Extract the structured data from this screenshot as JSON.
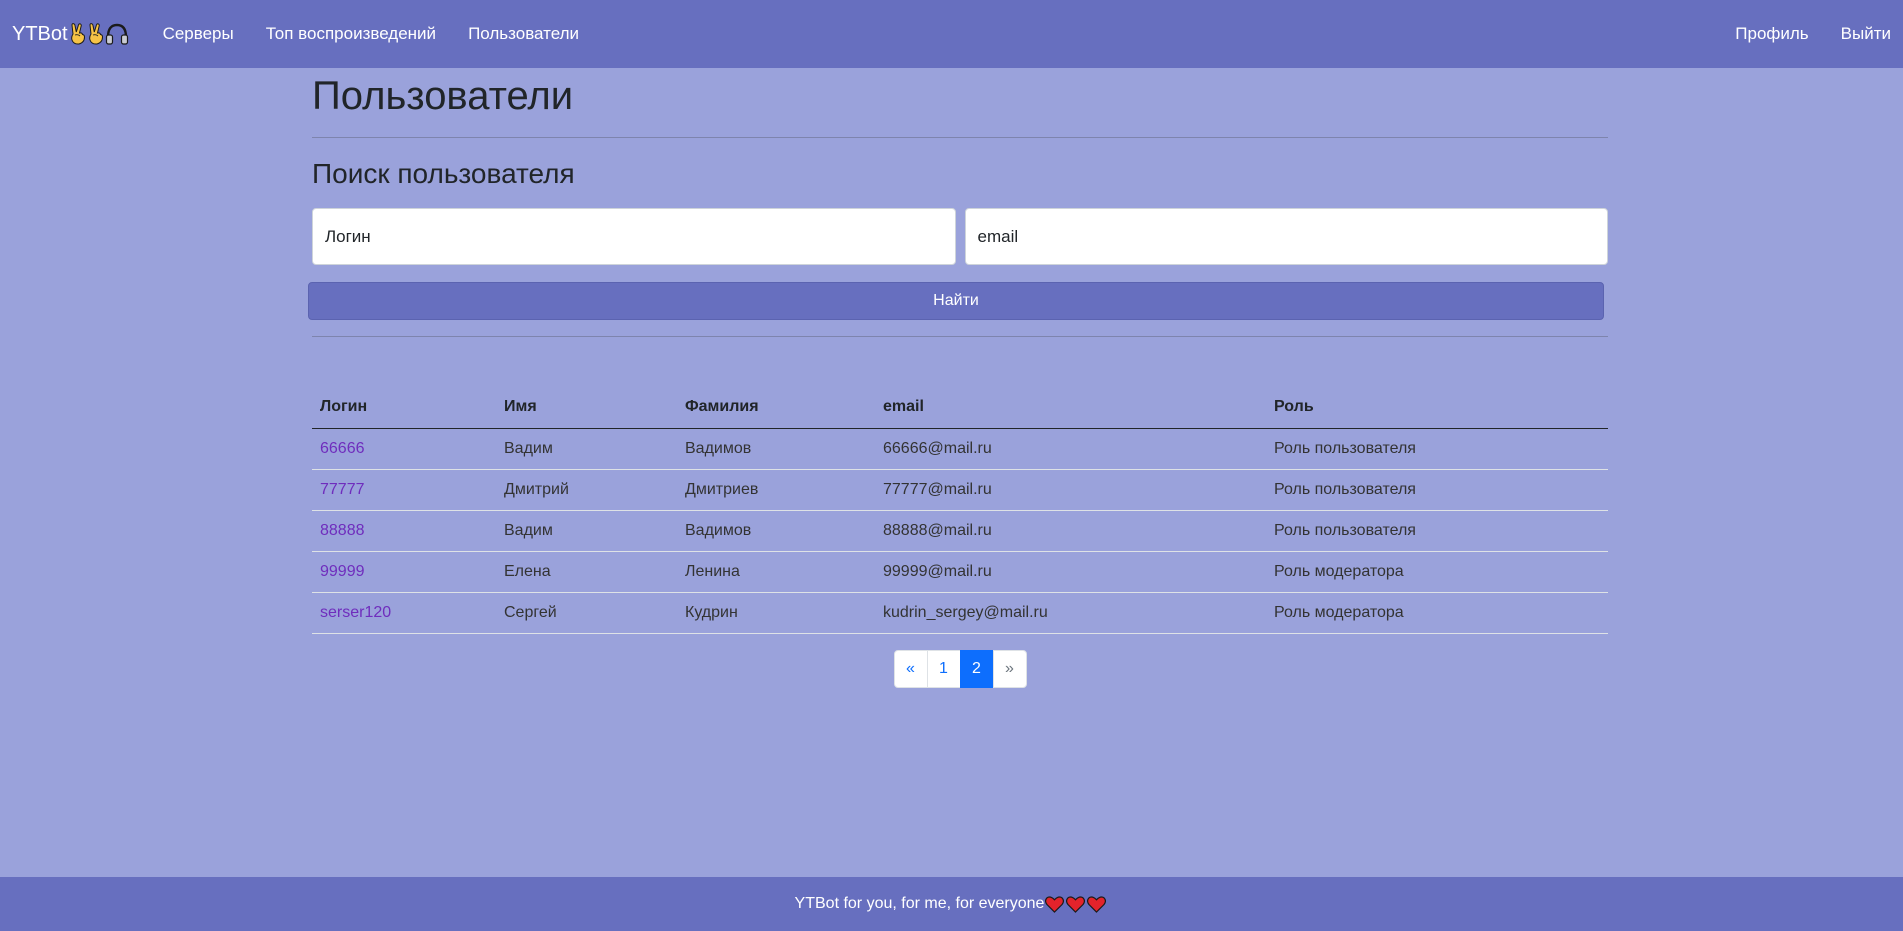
{
  "navbar": {
    "brand": "YTBot",
    "brand_icons": [
      "victory-hand-icon",
      "victory-hand-icon",
      "headphones-icon"
    ],
    "links": [
      "Серверы",
      "Топ воспроизведений",
      "Пользователи"
    ],
    "profile": "Профиль",
    "logout": "Выйти"
  },
  "page": {
    "title": "Пользователи",
    "search_title": "Поиск пользователя",
    "login_placeholder": "Логин",
    "email_placeholder": "email",
    "find_button": "Найти"
  },
  "table": {
    "headers": [
      "Логин",
      "Имя",
      "Фамилия",
      "email",
      "Роль"
    ],
    "rows": [
      [
        "66666",
        "Вадим",
        "Вадимов",
        "66666@mail.ru",
        "Роль пользователя"
      ],
      [
        "77777",
        "Дмитрий",
        "Дмитриев",
        "77777@mail.ru",
        "Роль пользователя"
      ],
      [
        "88888",
        "Вадим",
        "Вадимов",
        "88888@mail.ru",
        "Роль пользователя"
      ],
      [
        "99999",
        "Елена",
        "Ленина",
        "99999@mail.ru",
        "Роль модератора"
      ],
      [
        "serser120",
        "Сергей",
        "Кудрин",
        "kudrin_sergey@mail.ru",
        "Роль модератора"
      ]
    ]
  },
  "pagination": {
    "prev": "«",
    "pages": [
      "1",
      "2"
    ],
    "active": "2",
    "next": "»"
  },
  "footer": {
    "text": "YTBot for you, for me, for everyone",
    "icons": [
      "heart-icon",
      "heart-icon",
      "heart-icon"
    ]
  },
  "colors": {
    "navbar": "#676fbf",
    "background": "#9aa2db",
    "link": "#6f2dbd",
    "active_page": "#0d6efd"
  }
}
